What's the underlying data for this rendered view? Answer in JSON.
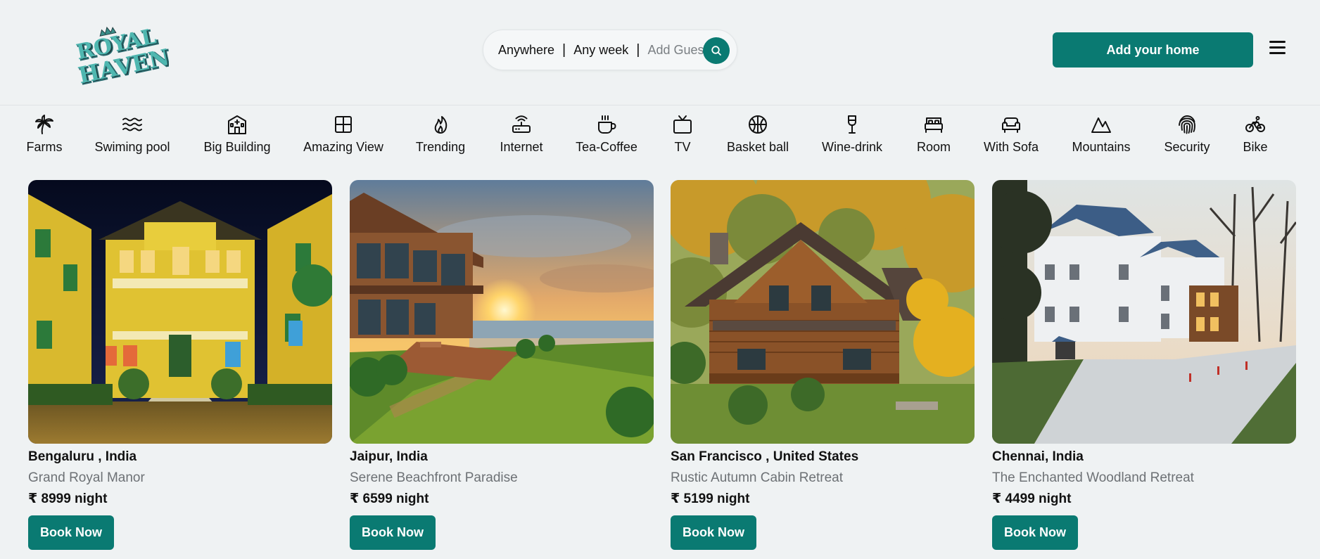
{
  "brand": {
    "logo_text_line1": "ROYAL",
    "logo_text_line2": "HAVEN"
  },
  "search": {
    "where": "Anywhere",
    "when": "Any week",
    "guests_placeholder": "Add Guest",
    "separator": "|",
    "button_icon": "search-icon"
  },
  "header": {
    "add_home_label": "Add your home",
    "menu_icon": "hamburger-menu-icon"
  },
  "categories": [
    {
      "label": "Farms",
      "icon": "palm-tree-icon"
    },
    {
      "label": "Swiming pool",
      "icon": "waves-icon"
    },
    {
      "label": "Big Building",
      "icon": "building-icon"
    },
    {
      "label": "Amazing View",
      "icon": "window-grid-icon"
    },
    {
      "label": "Trending",
      "icon": "flame-icon"
    },
    {
      "label": "Internet",
      "icon": "router-icon"
    },
    {
      "label": "Tea-Coffee",
      "icon": "coffee-cup-icon"
    },
    {
      "label": "TV",
      "icon": "tv-icon"
    },
    {
      "label": "Basket ball",
      "icon": "basketball-icon"
    },
    {
      "label": "Wine-drink",
      "icon": "wine-glass-icon"
    },
    {
      "label": "Room",
      "icon": "bed-icon"
    },
    {
      "label": "With Sofa",
      "icon": "sofa-icon"
    },
    {
      "label": "Mountains",
      "icon": "mountain-icon"
    },
    {
      "label": "Security",
      "icon": "fingerprint-icon"
    },
    {
      "label": "Bike",
      "icon": "bike-icon"
    }
  ],
  "listings": [
    {
      "location": "Bengaluru , India",
      "title": "Grand Royal Manor",
      "price": "₹ 8999 night",
      "button": "Book Now",
      "image": "yellow-mansion-night-photo"
    },
    {
      "location": "Jaipur, India",
      "title": "Serene Beachfront Paradise",
      "price": "₹ 6599 night",
      "button": "Book Now",
      "image": "beachfront-house-sunset-photo"
    },
    {
      "location": "San Francisco , United States",
      "title": "Rustic Autumn Cabin Retreat",
      "price": "₹ 5199 night",
      "button": "Book Now",
      "image": "log-cabin-autumn-photo"
    },
    {
      "location": "Chennai, India",
      "title": "The Enchanted Woodland Retreat",
      "price": "₹ 4499 night",
      "button": "Book Now",
      "image": "white-house-woodland-photo"
    }
  ],
  "colors": {
    "accent": "#0a7a72",
    "background": "#eff2f3",
    "muted_text": "#6d7175"
  }
}
